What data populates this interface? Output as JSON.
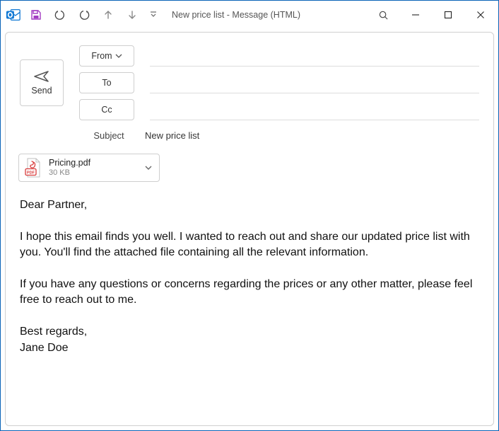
{
  "window": {
    "title": "New price list  -  Message (HTML)"
  },
  "toolbar": {
    "send_label": "Send",
    "from_label": "From",
    "to_label": "To",
    "cc_label": "Cc",
    "subject_label": "Subject",
    "subject_value": "New price list",
    "to_value": "",
    "cc_value": ""
  },
  "attachments": [
    {
      "name": "Pricing.pdf",
      "size": "30 KB"
    }
  ],
  "body_text": "Dear Partner,\n\nI hope this email finds you well. I wanted to reach out and share our updated price list with you. You'll find the attached file containing all the relevant information.\n\nIf you have any questions or concerns regarding the prices or any other matter, please feel free to reach out to me.\n\nBest regards,\nJane Doe"
}
